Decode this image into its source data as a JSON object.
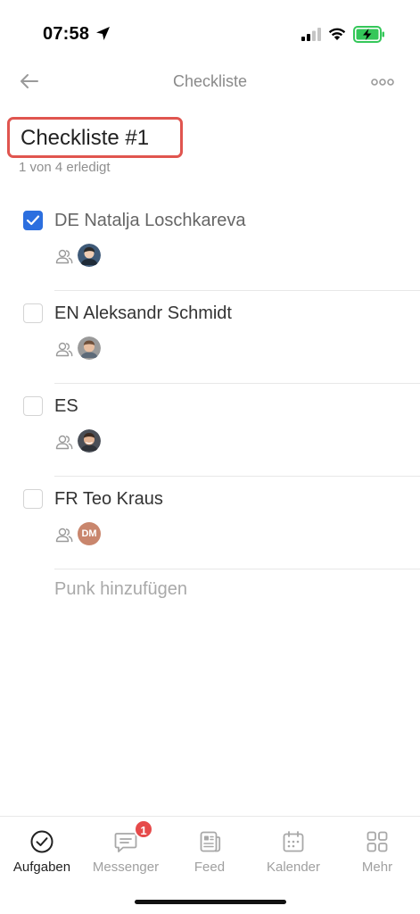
{
  "status_bar": {
    "time": "07:58",
    "icons": [
      "location-arrow-icon",
      "cellular-signal-icon",
      "wifi-icon",
      "battery-charging-icon"
    ],
    "battery_color": "#34c759"
  },
  "nav": {
    "title": "Checkliste",
    "back_icon": "arrow-left-icon",
    "more_icon": "more-dots-icon"
  },
  "checklist": {
    "title": "Checkliste #1",
    "progress": "1 von 4 erledigt",
    "highlight_color": "#e0554f",
    "accent_color": "#2c6fdf",
    "items": [
      {
        "label": "DE Natalja Loschkareva",
        "checked": true
      },
      {
        "label": "EN Aleksandr Schmidt",
        "checked": false
      },
      {
        "label": "ES",
        "checked": false
      },
      {
        "label": "FR Teo Kraus",
        "checked": false,
        "avatar_initials": "DM"
      }
    ],
    "add_placeholder": "Punk hinzufügen"
  },
  "tabs": [
    {
      "label": "Aufgaben",
      "icon": "check-circle-icon",
      "active": true
    },
    {
      "label": "Messenger",
      "icon": "chat-bubble-icon",
      "badge": "1"
    },
    {
      "label": "Feed",
      "icon": "newspaper-icon"
    },
    {
      "label": "Kalender",
      "icon": "calendar-icon"
    },
    {
      "label": "Mehr",
      "icon": "grid-icon"
    }
  ]
}
